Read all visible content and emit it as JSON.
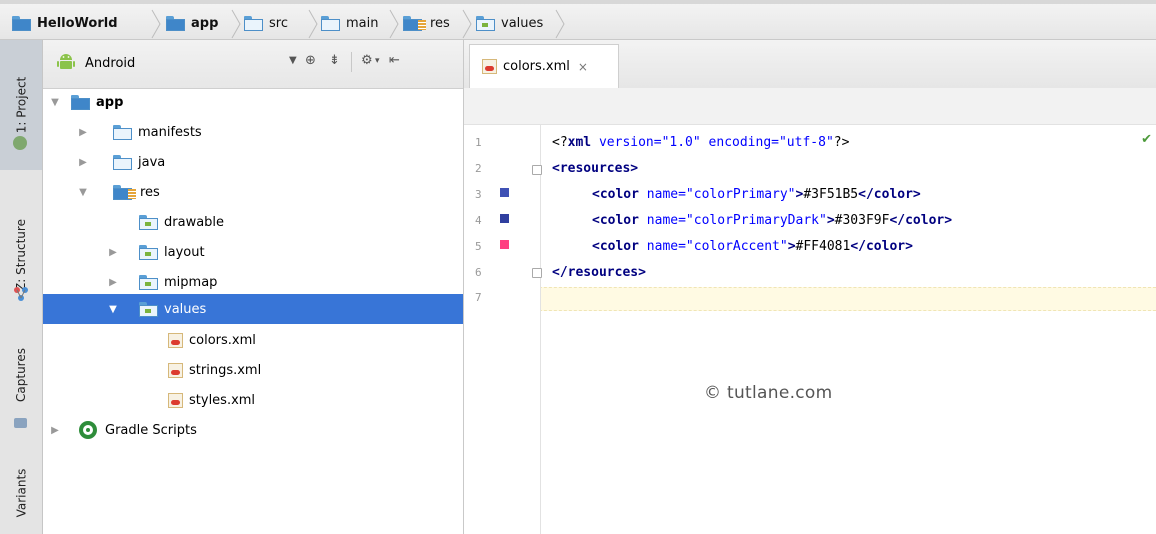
{
  "breadcrumb": {
    "items": [
      {
        "label": "HelloWorld",
        "icon": "module-folder-icon"
      },
      {
        "label": "app",
        "icon": "module-folder-icon"
      },
      {
        "label": "src",
        "icon": "folder-icon"
      },
      {
        "label": "main",
        "icon": "folder-icon"
      },
      {
        "label": "res",
        "icon": "resource-folder-icon"
      },
      {
        "label": "values",
        "icon": "package-folder-icon"
      }
    ]
  },
  "tool_strip": {
    "project": "1: Project",
    "structure": "Z: Structure",
    "captures": "Captures",
    "variants": "Variants"
  },
  "project_panel": {
    "view_mode": "Android",
    "tree": {
      "app": "app",
      "manifests": "manifests",
      "java": "java",
      "res": "res",
      "drawable": "drawable",
      "layout": "layout",
      "mipmap": "mipmap",
      "values": "values",
      "colors": "colors.xml",
      "strings": "strings.xml",
      "styles": "styles.xml",
      "gradle": "Gradle Scripts"
    }
  },
  "editor": {
    "tab_label": "colors.xml",
    "tab_close": "×",
    "line_numbers": [
      "1",
      "2",
      "3",
      "4",
      "5",
      "6",
      "7"
    ],
    "code": {
      "l1_decl_start": "<?",
      "l1_decl_name": "xml",
      "l1_attrs": " version=\"1.0\" encoding=\"utf-8\"",
      "l1_decl_end": "?>",
      "l2": "<resources>",
      "l3_open": "<color ",
      "l3_attr": "name=\"colorPrimary\"",
      "l3_value": "#3F51B5",
      "l4_attr": "name=\"colorPrimaryDark\"",
      "l4_value": "#303F9F",
      "l5_attr": "name=\"colorAccent\"",
      "l5_value": "#FF4081",
      "close_color": "</color>",
      "l6": "</resources>"
    },
    "swatches": [
      "#3F51B5",
      "#303F9F",
      "#FF4081"
    ]
  },
  "watermark": "© tutlane.com",
  "colors": {
    "selection": "#3875d7",
    "tag": "#000080",
    "string": "#008000"
  }
}
